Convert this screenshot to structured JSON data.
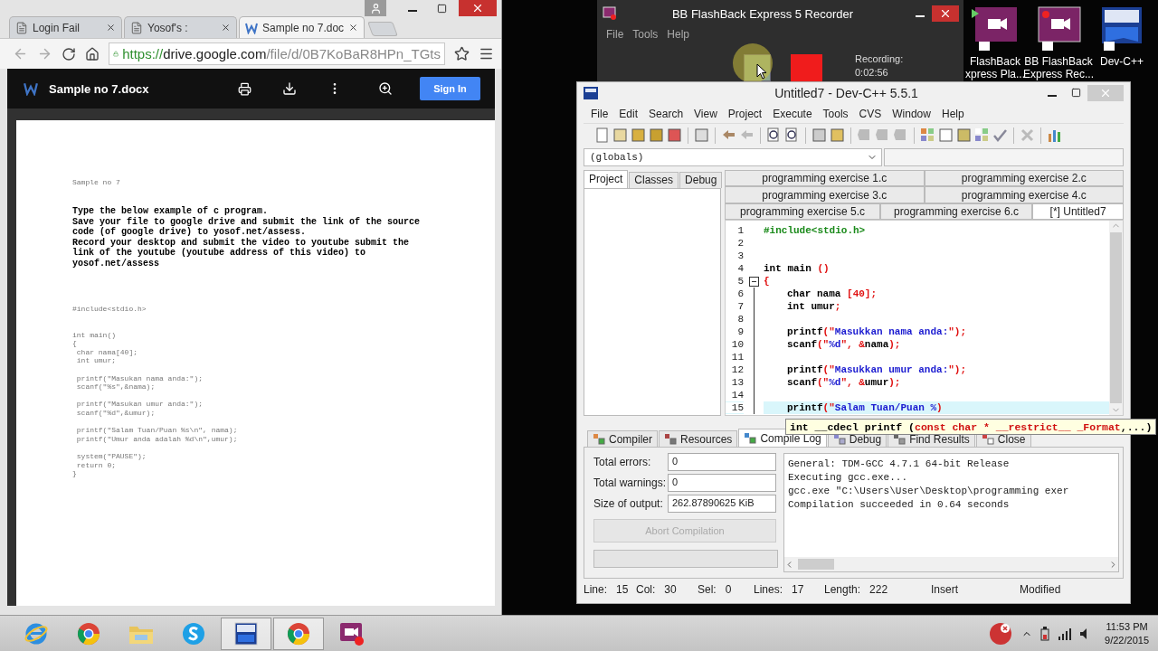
{
  "browser": {
    "tabs": [
      {
        "label": "Login Fail",
        "kind": "page",
        "selected": false
      },
      {
        "label": "Yosof's :",
        "kind": "page",
        "selected": false
      },
      {
        "label": "Sample no 7.doc",
        "kind": "word",
        "selected": true
      }
    ],
    "address": {
      "scheme": "https://",
      "host": "drive.google.com",
      "path": "/file/d/0B7KoBaR8HPn_TGts"
    },
    "viewer": {
      "title": "Sample no 7.docx",
      "sign_in": "Sign In"
    },
    "document": {
      "heading": "Sample no 7",
      "instructions": [
        "Type the below example of c program.",
        "Save your file to google drive and submit the link of the source",
        "code (of google drive) to yosof.net/assess.",
        "Record your desktop and submit the video to youtube submit the",
        "link of the youtube (youtube address of this video) to",
        "yosof.net/assess"
      ],
      "code_blocks": [
        [
          "#include<stdio.h>"
        ],
        [
          "int main()",
          "{",
          " char nama[40];",
          " int umur;"
        ],
        [
          " printf(\"Masukan nama anda:\");",
          " scanf(\"%s\",&nama);"
        ],
        [
          " printf(\"Masukan umur anda:\");",
          " scanf(\"%d\",&umur);"
        ],
        [
          " printf(\"Salam Tuan/Puan %s\\n\", nama);",
          " printf(\"Umur anda adalah %d\\n\",umur);"
        ],
        [
          " system(\"PAUSE\");",
          " return 0;",
          "}"
        ]
      ]
    }
  },
  "recorder": {
    "title": "BB FlashBack Express 5 Recorder",
    "menu": [
      "File",
      "Tools",
      "Help"
    ],
    "status": "Recording:",
    "time": "0:02:56"
  },
  "desktop_icons": [
    {
      "kind": "player",
      "lines": [
        "FlashBack",
        "xpress Pla..."
      ]
    },
    {
      "kind": "recorder",
      "lines": [
        "BB FlashBack",
        "Express Rec..."
      ]
    },
    {
      "kind": "dev",
      "lines": [
        "Dev-C++"
      ]
    }
  ],
  "devcpp": {
    "title": "Untitled7 - Dev-C++ 5.5.1",
    "menu": [
      "File",
      "Edit",
      "Search",
      "View",
      "Project",
      "Execute",
      "Tools",
      "CVS",
      "Window",
      "Help"
    ],
    "scope": "(globals)",
    "side_tabs": [
      {
        "label": "Project",
        "selected": true
      },
      {
        "label": "Classes",
        "selected": false
      },
      {
        "label": "Debug",
        "selected": false
      }
    ],
    "editor_tab_rows": [
      [
        {
          "label": "programming exercise 1.c",
          "selected": false
        },
        {
          "label": "programming exercise 2.c",
          "selected": false
        }
      ],
      [
        {
          "label": "programming exercise 3.c",
          "selected": false
        },
        {
          "label": "programming exercise 4.c",
          "selected": false
        }
      ],
      [
        {
          "label": "programming exercise 5.c",
          "selected": false
        },
        {
          "label": "programming exercise 6.c",
          "selected": false
        },
        {
          "label": "[*] Untitled7",
          "selected": true
        }
      ]
    ],
    "code": [
      {
        "number": "1",
        "selected": false,
        "tokens": [
          {
            "text": "#include<stdio.h>",
            "kind": "preproc"
          }
        ]
      },
      {
        "number": "2",
        "selected": false
      },
      {
        "number": "3",
        "selected": false
      },
      {
        "number": "4",
        "selected": false,
        "tokens": [
          {
            "text": "int",
            "kind": "keyword"
          },
          {
            "text": " main ",
            "kind": "plain"
          },
          {
            "text": "()",
            "kind": "symbol"
          }
        ]
      },
      {
        "number": "5",
        "selected": false,
        "tokens": [
          {
            "text": "{",
            "kind": "symbol"
          }
        ],
        "children": [
          {
            "number": "6",
            "selected": false,
            "tokens": [
              {
                "text": "char",
                "kind": "keyword"
              },
              {
                "text": " nama ",
                "kind": "plain"
              },
              {
                "text": "[",
                "kind": "symbol"
              },
              {
                "text": "40",
                "kind": "number"
              },
              {
                "text": "];",
                "kind": "symbol"
              }
            ]
          },
          {
            "number": "7",
            "selected": false,
            "tokens": [
              {
                "text": "int",
                "kind": "keyword"
              },
              {
                "text": " umur",
                "kind": "plain"
              },
              {
                "text": ";",
                "kind": "symbol"
              }
            ]
          },
          {
            "number": "8",
            "selected": false
          },
          {
            "number": "9",
            "selected": false,
            "tokens": [
              {
                "text": "printf",
                "kind": "plain"
              },
              {
                "text": "(\"",
                "kind": "symbol"
              },
              {
                "text": "Masukkan nama anda:",
                "kind": "string"
              },
              {
                "text": "\");",
                "kind": "symbol"
              }
            ]
          },
          {
            "number": "10",
            "selected": false,
            "tokens": [
              {
                "text": "scanf",
                "kind": "plain"
              },
              {
                "text": "(\"",
                "kind": "symbol"
              },
              {
                "text": "%d",
                "kind": "string"
              },
              {
                "text": "\", &",
                "kind": "symbol"
              },
              {
                "text": "nama",
                "kind": "plain"
              },
              {
                "text": ");",
                "kind": "symbol"
              }
            ]
          },
          {
            "number": "11",
            "selected": false
          },
          {
            "number": "12",
            "selected": false,
            "tokens": [
              {
                "text": "printf",
                "kind": "plain"
              },
              {
                "text": "(\"",
                "kind": "symbol"
              },
              {
                "text": "Masukkan umur anda:",
                "kind": "string"
              },
              {
                "text": "\");",
                "kind": "symbol"
              }
            ]
          },
          {
            "number": "13",
            "selected": false,
            "tokens": [
              {
                "text": "scanf",
                "kind": "plain"
              },
              {
                "text": "(\"",
                "kind": "symbol"
              },
              {
                "text": "%d",
                "kind": "string"
              },
              {
                "text": "\", &",
                "kind": "symbol"
              },
              {
                "text": "umur",
                "kind": "plain"
              },
              {
                "text": ");",
                "kind": "symbol"
              }
            ]
          },
          {
            "number": "14",
            "selected": false
          },
          {
            "number": "15",
            "selected": true,
            "tokens": [
              {
                "text": "printf",
                "kind": "plain"
              },
              {
                "text": "(\"",
                "kind": "symbol"
              },
              {
                "text": "Salam Tuan/Puan %",
                "kind": "string"
              },
              {
                "text": ")",
                "kind": "symbol"
              }
            ]
          }
        ]
      }
    ],
    "calltip": [
      {
        "text": "int __cdecl printf (",
        "kind": "plain"
      },
      {
        "text": "const char * __restrict__ _Format",
        "kind": "param"
      },
      {
        "text": ",...)",
        "kind": "plain"
      }
    ],
    "bottom_tabs": [
      {
        "label": "Compiler",
        "selected": false
      },
      {
        "label": "Resources",
        "selected": false
      },
      {
        "label": "Compile Log",
        "selected": true
      },
      {
        "label": "Debug",
        "selected": false
      },
      {
        "label": "Find Results",
        "selected": false
      },
      {
        "label": "Close",
        "selected": false
      }
    ],
    "stats": [
      {
        "label": "Total errors:",
        "value": "0"
      },
      {
        "label": "Total warnings:",
        "value": "0"
      },
      {
        "label": "Size of output:",
        "value": "262.87890625 KiB"
      }
    ],
    "abort_button": {
      "label": "Abort Compilation",
      "disabled": true
    },
    "progress": {
      "level": 0
    },
    "log": [
      "General: TDM-GCC 4.7.1 64-bit Release",
      "Executing gcc.exe...",
      "gcc.exe \"C:\\Users\\User\\Desktop\\programming exer",
      "Compilation succeeded in 0.64 seconds"
    ],
    "status_bar": [
      {
        "label": "Line:",
        "value": "15"
      },
      {
        "label": "Col:",
        "value": "30"
      },
      {
        "label": "Sel:",
        "value": "0"
      },
      {
        "label": "Lines:",
        "value": "17"
      },
      {
        "label": "Length:",
        "value": "222"
      },
      {
        "value": "Insert"
      },
      {
        "value": "Modified"
      }
    ]
  },
  "taskbar": {
    "apps": [
      {
        "kind": "ie",
        "open": false
      },
      {
        "kind": "chrome",
        "open": false
      },
      {
        "kind": "folder",
        "open": false
      },
      {
        "kind": "skype",
        "open": false
      },
      {
        "kind": "dev",
        "open": true
      },
      {
        "kind": "chrome",
        "open": true
      },
      {
        "kind": "recorder",
        "open": false
      }
    ],
    "time": "11:53 PM",
    "date": "9/22/2015"
  }
}
